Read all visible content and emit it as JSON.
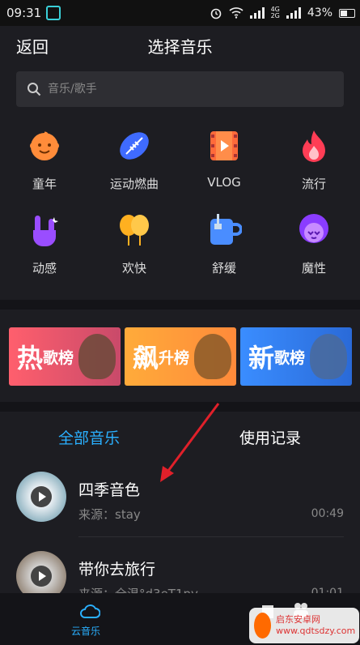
{
  "status": {
    "time": "09:31",
    "net_top": "4G",
    "net_bottom": "2G",
    "battery": "43%"
  },
  "header": {
    "back": "返回",
    "title": "选择音乐"
  },
  "search": {
    "placeholder": "音乐/歌手"
  },
  "categories": [
    {
      "label": "童年",
      "icon": "baby-face-icon"
    },
    {
      "label": "运动燃曲",
      "icon": "football-icon"
    },
    {
      "label": "VLOG",
      "icon": "film-icon"
    },
    {
      "label": "流行",
      "icon": "flame-icon"
    },
    {
      "label": "动感",
      "icon": "rock-hand-icon"
    },
    {
      "label": "欢快",
      "icon": "balloon-icon"
    },
    {
      "label": "舒缓",
      "icon": "mug-icon"
    },
    {
      "label": "魔性",
      "icon": "afro-face-icon"
    }
  ],
  "rankings": [
    {
      "big": "热",
      "small": "歌榜"
    },
    {
      "big": "飙",
      "small": "升榜"
    },
    {
      "big": "新",
      "small": "歌榜"
    }
  ],
  "tabs": {
    "all": "全部音乐",
    "history": "使用记录"
  },
  "songs": [
    {
      "name": "四季音色",
      "source": "来源：stay",
      "duration": "00:49"
    },
    {
      "name": "带你去旅行",
      "source": "来源：全温°d3eT1py",
      "duration": "01:01"
    }
  ],
  "bottom_nav": {
    "cloud_music": "云音乐"
  },
  "watermark": "启东安卓网 www.qdtsdzy.com",
  "colors": {
    "accent": "#2ab0ff",
    "background": "#1d1d22",
    "band": "#141418"
  }
}
